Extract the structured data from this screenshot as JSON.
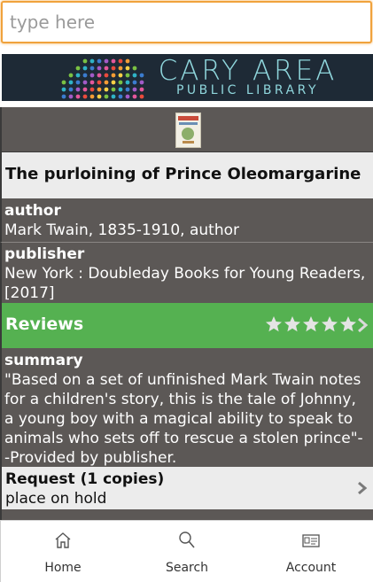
{
  "search": {
    "placeholder": "type here",
    "value": ""
  },
  "banner": {
    "line1": "CARY AREA",
    "line2": "PUBLIC LIBRARY"
  },
  "book": {
    "title": "The purloining of Prince Oleomargarine",
    "author_label": "author",
    "author": "Mark Twain, 1835-1910, author",
    "publisher_label": "publisher",
    "publisher": "New York : Doubleday Books for Young Readers, [2017]",
    "summary_label": "summary",
    "summary": "\"Based on a set of unfinished Mark Twain notes for a children's story, this is the tale of Johnny, a young boy with a magical ability to speak to animals who sets off to rescue a stolen prince\"--Provided by publisher."
  },
  "reviews": {
    "label": "Reviews",
    "rating": 0,
    "max_rating": 5
  },
  "request": {
    "label": "Request (1 copies)",
    "sublabel": "place on hold"
  },
  "tabs": [
    {
      "label": "Home",
      "icon": "home-icon"
    },
    {
      "label": "Search",
      "icon": "search-icon"
    },
    {
      "label": "Account",
      "icon": "account-card-icon"
    }
  ],
  "colors": {
    "accent_orange": "#f0a23c",
    "reviews_green": "#55b151",
    "panel_gray": "#5c5856",
    "light_row": "#ececec",
    "banner_navy": "#1e2a36"
  }
}
